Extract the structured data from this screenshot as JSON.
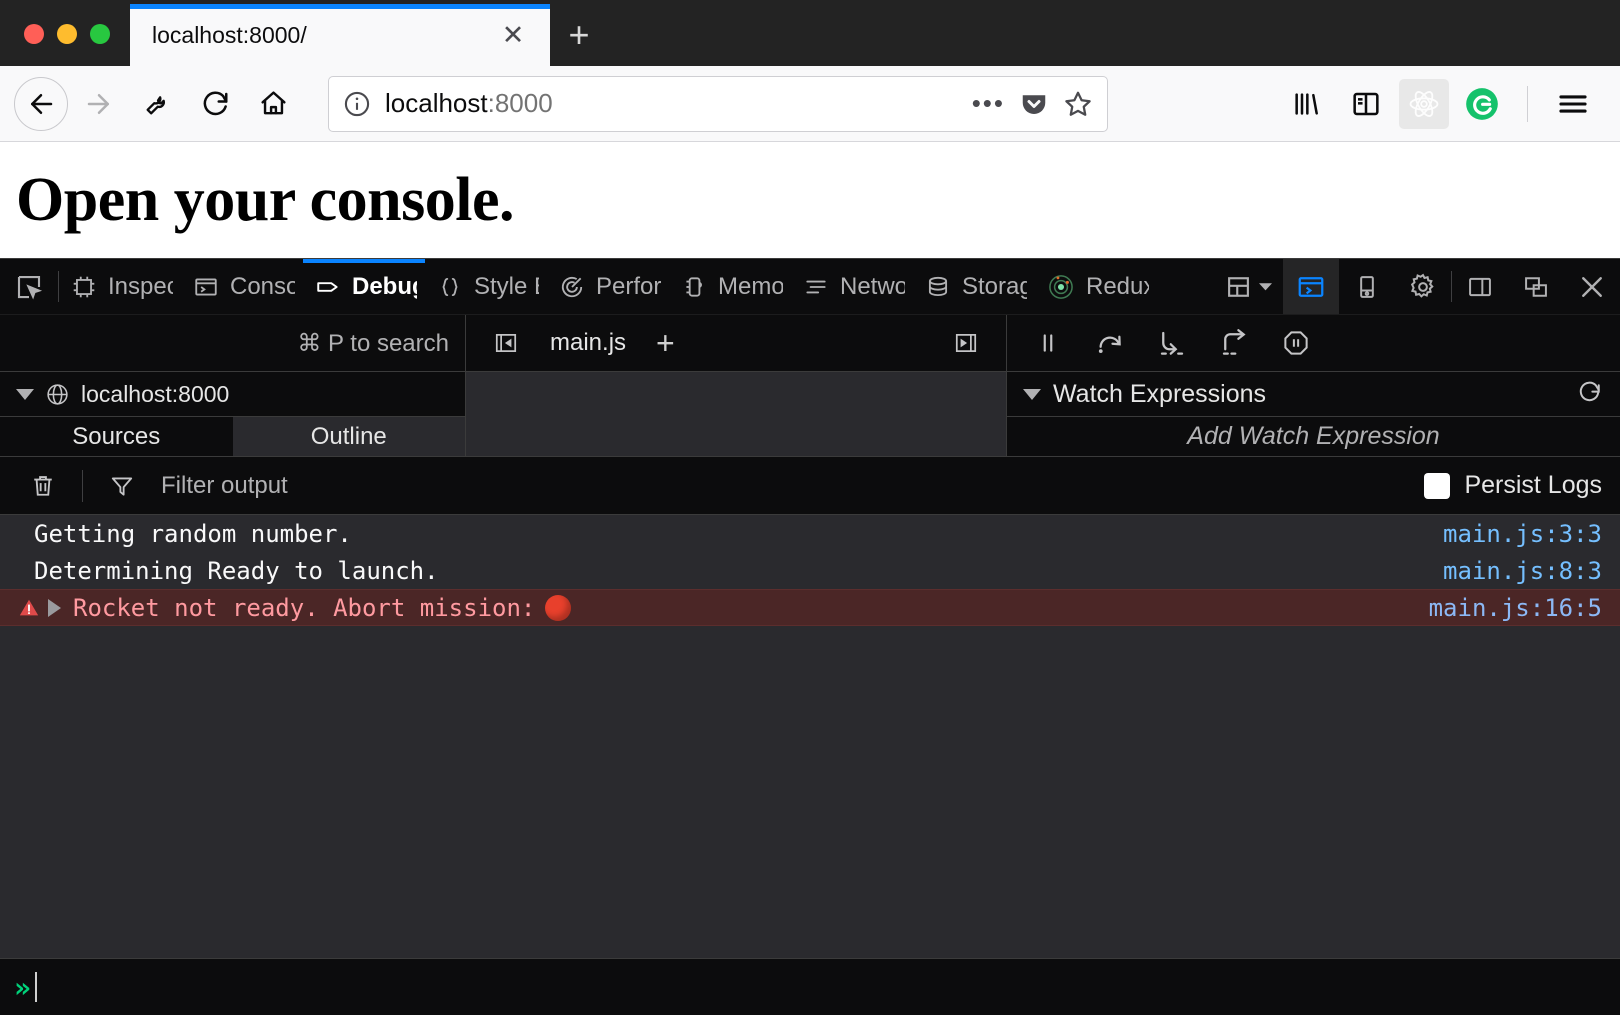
{
  "browser": {
    "window_controls": [
      "close",
      "minimize",
      "maximize"
    ],
    "tab": {
      "title": "localhost:8000/",
      "close_label": "✕"
    },
    "new_tab_label": "+",
    "nav": {
      "back": "back-arrow",
      "forward": "forward-arrow",
      "wrench": "wrench",
      "reload": "reload",
      "home": "home"
    },
    "urlbar": {
      "host": "localhost",
      "port": ":8000",
      "info_icon": "info-circle",
      "more_label": "•••",
      "pocket_icon": "pocket",
      "bookmark_icon": "star"
    },
    "extensions": [
      "library",
      "sidebars",
      "react-devtools",
      "grammarly"
    ],
    "menu_label": "hamburger-menu"
  },
  "page": {
    "heading": "Open your console."
  },
  "devtools": {
    "picker_icon": "element-picker",
    "tabs": [
      {
        "label": "Inspector",
        "icon": "inspector-icon",
        "selected": false
      },
      {
        "label": "Console",
        "icon": "console-icon",
        "selected": false
      },
      {
        "label": "Debugger",
        "icon": "debugger-icon",
        "selected": true
      },
      {
        "label": "Style Editor",
        "icon": "braces-icon",
        "selected": false
      },
      {
        "label": "Performance",
        "icon": "performance-icon",
        "selected": false
      },
      {
        "label": "Memory",
        "icon": "memory-icon",
        "selected": false
      },
      {
        "label": "Network",
        "icon": "network-icon",
        "selected": false
      },
      {
        "label": "Storage",
        "icon": "storage-icon",
        "selected": false
      },
      {
        "label": "Redux",
        "icon": "redux-icon",
        "selected": false
      }
    ],
    "toolbar_right": [
      {
        "name": "responsive-design-mode",
        "icon": "layout-dropdown"
      },
      {
        "name": "split-console",
        "icon": "split-console",
        "active": true
      },
      {
        "name": "responsive-mode",
        "icon": "device"
      },
      {
        "name": "settings",
        "icon": "gear"
      },
      {
        "name": "dock-side",
        "icon": "dock-panel"
      },
      {
        "name": "separate-window",
        "icon": "detach-window"
      },
      {
        "name": "close-devtools",
        "icon": "close-x"
      }
    ],
    "accent_color": "#0a84ff"
  },
  "debugger": {
    "search_hint": "⌘ P to search",
    "editor_tabs": {
      "prev_icon": "jump-to-previous",
      "next_icon": "jump-to-next",
      "open_file": "main.js",
      "add_label": "+"
    },
    "controls": [
      {
        "name": "resume",
        "icon": "pause-resume",
        "title": "Pause"
      },
      {
        "name": "step-over",
        "icon": "step-over"
      },
      {
        "name": "step-in",
        "icon": "step-in"
      },
      {
        "name": "step-out",
        "icon": "step-out"
      },
      {
        "name": "pause-on-exceptions",
        "icon": "pause-octagon"
      }
    ],
    "sources": {
      "root_label": "localhost:8000",
      "root_icon": "globe-icon",
      "subtabs": [
        {
          "label": "Sources",
          "selected": true
        },
        {
          "label": "Outline",
          "selected": false
        }
      ]
    },
    "watch": {
      "title": "Watch Expressions",
      "refresh_icon": "refresh-icon",
      "add_placeholder": "Add Watch Expression"
    }
  },
  "console": {
    "filterbar": {
      "clear_icon": "trash-icon",
      "filter_icon": "funnel-icon",
      "filter_placeholder": "Filter output",
      "persist_label": "Persist Logs",
      "persist_checked": false
    },
    "messages": [
      {
        "text": "Getting random number.",
        "source": "main.js:3:3",
        "level": "log",
        "expandable": false,
        "has_object": false
      },
      {
        "text": "Determining Ready to launch.",
        "source": "main.js:8:3",
        "level": "log",
        "expandable": false,
        "has_object": false
      },
      {
        "text": "Rocket not ready. Abort mission:",
        "source": "main.js:16:5",
        "level": "error",
        "expandable": true,
        "has_object": true,
        "object_glyph": "red-circle-emoji"
      }
    ],
    "input": {
      "prompt": "»",
      "value": ""
    }
  }
}
